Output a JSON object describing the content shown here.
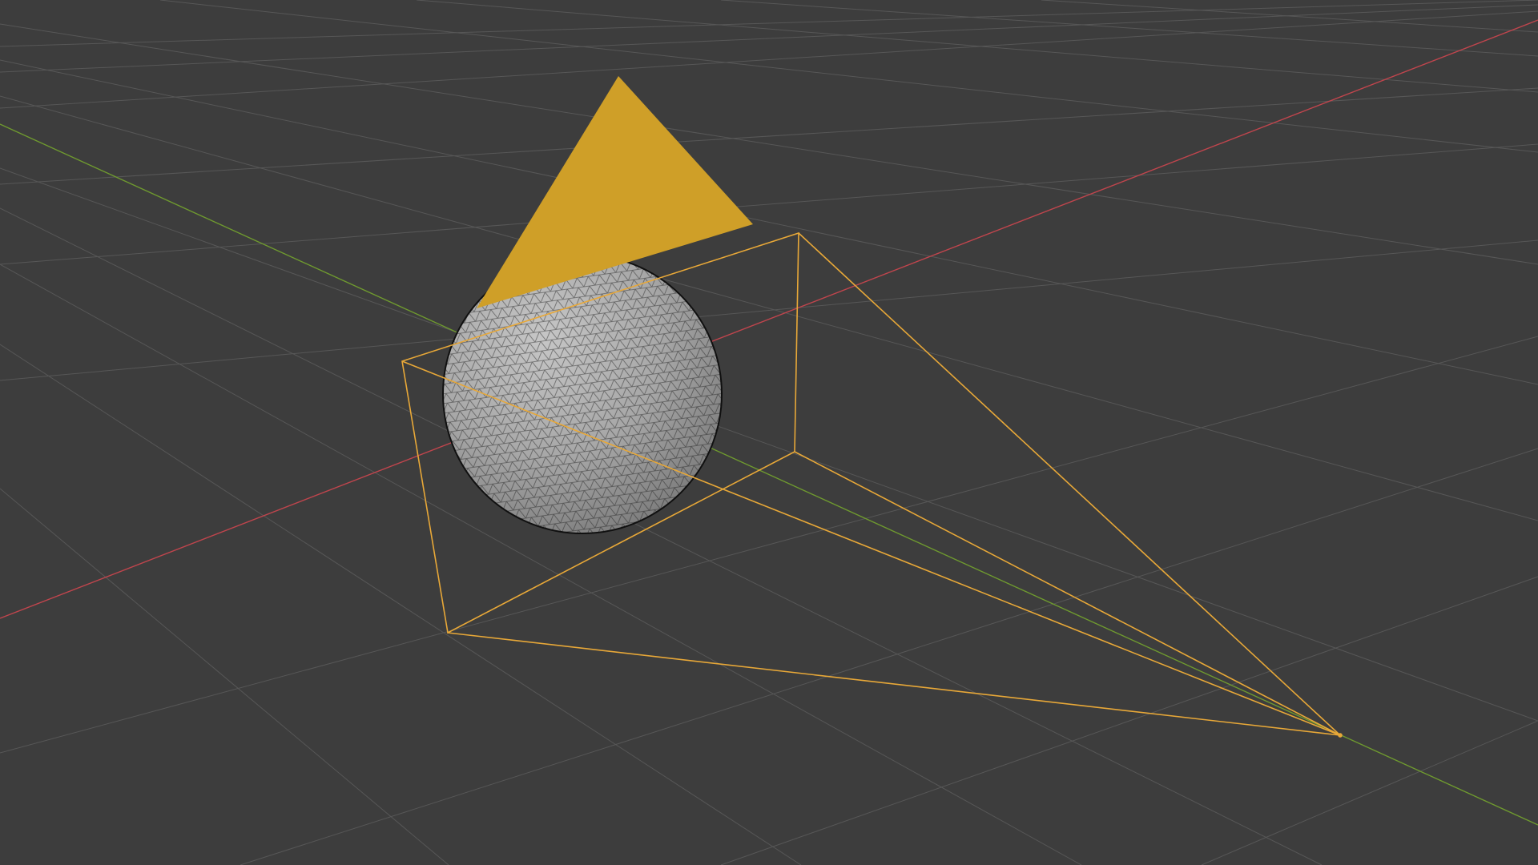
{
  "viewport": {
    "background_color": "#3d3d3d",
    "grid_color": "#575757",
    "axis_x_color": "#c0454d",
    "axis_y_color": "#6f9a2f",
    "selection_color": "#e8a838",
    "active_fill_color": "#cf9f28",
    "mesh_fill_color": "#a9a9a9",
    "mesh_wire_color": "#1d1d1d"
  },
  "scene_objects": [
    {
      "type": "cone",
      "selected": true,
      "icon": "cone-icon"
    },
    {
      "type": "ico-sphere",
      "selected": false,
      "icon": "sphere-icon"
    },
    {
      "type": "camera",
      "selected": true,
      "icon": "camera-icon"
    }
  ]
}
